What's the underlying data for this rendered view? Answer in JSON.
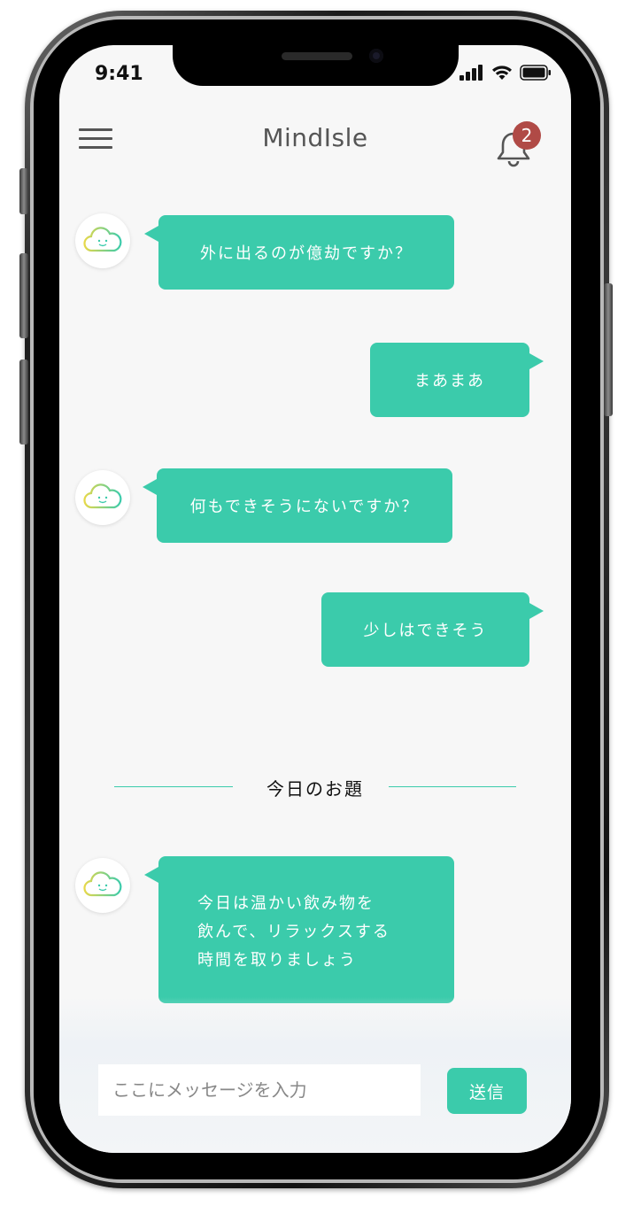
{
  "status_bar": {
    "time": "9:41"
  },
  "header": {
    "title": "MindIsle",
    "notification_count": "2"
  },
  "messages": [
    {
      "sender": "bot",
      "text": "外に出るのが億劫ですか？"
    },
    {
      "sender": "user",
      "text": "まあまあ"
    },
    {
      "sender": "bot",
      "text": "何もできそうにないですか？"
    },
    {
      "sender": "user",
      "text": "少しはできそう"
    }
  ],
  "topic": {
    "label": "今日のお題",
    "lines": [
      "今日は温かい飲み物を",
      "飲んで、リラックスする",
      "時間を取りましょう"
    ]
  },
  "composer": {
    "placeholder": "ここにメッセージを入力",
    "send_label": "送信"
  },
  "colors": {
    "accent": "#3bcbab",
    "badge": "#b04a46",
    "background": "#f7f7f7"
  }
}
